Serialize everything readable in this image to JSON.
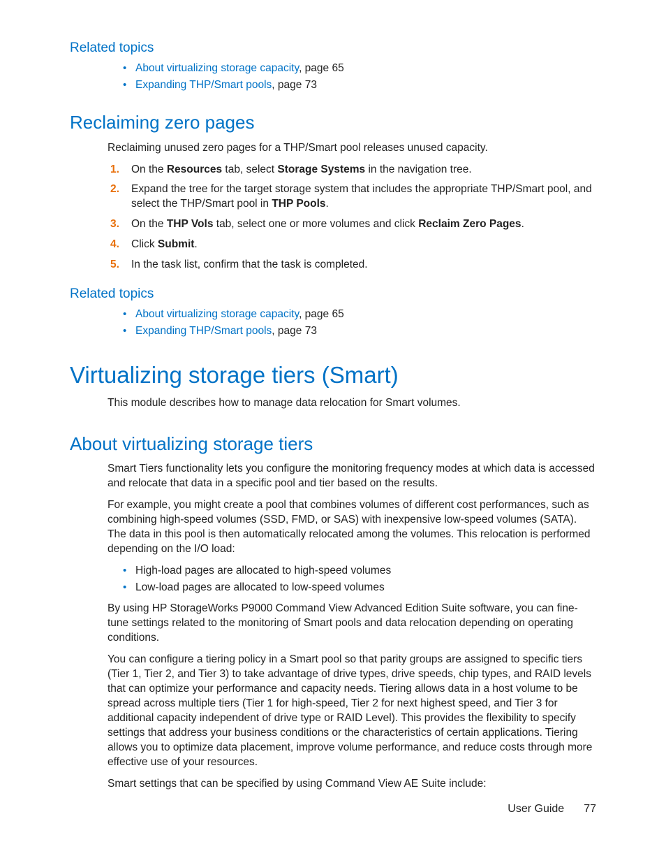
{
  "related1": {
    "heading": "Related topics",
    "items": [
      {
        "link": "About virtualizing storage capacity",
        "suffix": ", page 65"
      },
      {
        "link": "Expanding THP/Smart pools",
        "suffix": ", page 73"
      }
    ]
  },
  "reclaiming": {
    "heading": "Reclaiming zero pages",
    "intro": "Reclaiming unused zero pages for a THP/Smart pool releases unused capacity.",
    "steps": {
      "s1a": "On the ",
      "s1b": "Resources",
      "s1c": " tab, select ",
      "s1d": "Storage Systems",
      "s1e": " in the navigation tree.",
      "s2a": "Expand the tree for the target storage system that includes the appropriate THP/Smart pool, and select the THP/Smart pool in ",
      "s2b": "THP Pools",
      "s2c": ".",
      "s3a": "On the ",
      "s3b": "THP Vols",
      "s3c": " tab, select one or more volumes and click ",
      "s3d": "Reclaim Zero Pages",
      "s3e": ".",
      "s4a": "Click ",
      "s4b": "Submit",
      "s4c": ".",
      "s5": "In the task list, confirm that the task is completed."
    }
  },
  "related2": {
    "heading": "Related topics",
    "items": [
      {
        "link": "About virtualizing storage capacity",
        "suffix": ", page 65"
      },
      {
        "link": "Expanding THP/Smart pools",
        "suffix": ", page 73"
      }
    ]
  },
  "virt": {
    "heading": "Virtualizing storage tiers (Smart)",
    "intro": "This module describes how to manage data relocation for Smart volumes."
  },
  "about": {
    "heading": "About virtualizing storage tiers",
    "p1": "Smart Tiers functionality lets you configure the monitoring frequency modes at which data is accessed and relocate that data in a specific pool and tier based on the results.",
    "p2": "For example, you might create a pool that combines volumes of different cost performances, such as combining high-speed volumes (SSD, FMD, or SAS) with inexpensive low-speed volumes (SATA). The data in this pool is then automatically relocated among the volumes. This relocation is performed depending on the I/O load:",
    "bullets": [
      "High-load pages are allocated to high-speed volumes",
      "Low-load pages are allocated to low-speed volumes"
    ],
    "p3": "By using HP StorageWorks P9000 Command View Advanced Edition Suite software, you can fine-tune settings related to the monitoring of Smart pools and data relocation depending on operating conditions.",
    "p4": "You can configure a tiering policy in a Smart pool so that parity groups are assigned to specific tiers (Tier 1, Tier 2, and Tier 3) to take advantage of drive types, drive speeds, chip types, and RAID levels that can optimize your performance and capacity needs. Tiering allows data in a host volume to be spread across multiple tiers (Tier 1 for high-speed, Tier 2 for next highest speed, and Tier 3 for additional capacity independent of drive type or RAID Level). This provides the flexibility to specify settings that address your business conditions or the characteristics of certain applications. Tiering allows you to optimize data placement, improve volume performance, and reduce costs through more effective use of your resources.",
    "p5": "Smart settings that can be specified by using Command View AE Suite include:"
  },
  "footer": {
    "label": "User Guide",
    "page": "77"
  }
}
